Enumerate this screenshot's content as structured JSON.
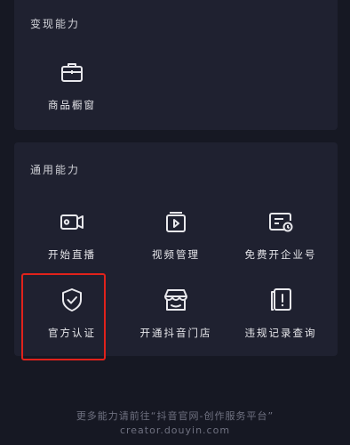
{
  "sections": {
    "monetize": {
      "title": "变现能力",
      "items": [
        {
          "label": "商品橱窗",
          "icon": "briefcase-icon"
        }
      ]
    },
    "general": {
      "title": "通用能力",
      "items": [
        {
          "label": "开始直播",
          "icon": "video-camera-icon"
        },
        {
          "label": "视频管理",
          "icon": "video-folder-icon"
        },
        {
          "label": "免费开企业号",
          "icon": "enterprise-card-icon"
        },
        {
          "label": "官方认证",
          "icon": "shield-check-icon"
        },
        {
          "label": "开通抖音门店",
          "icon": "store-icon"
        },
        {
          "label": "违规记录查询",
          "icon": "violation-record-icon"
        }
      ]
    }
  },
  "footer": {
    "notice": "更多能力请前往“抖音官网-创作服务平台”",
    "url": "creator.douyin.com"
  },
  "colors": {
    "background": "#161823",
    "card": "#1f2130",
    "highlight": "#e0221b"
  }
}
